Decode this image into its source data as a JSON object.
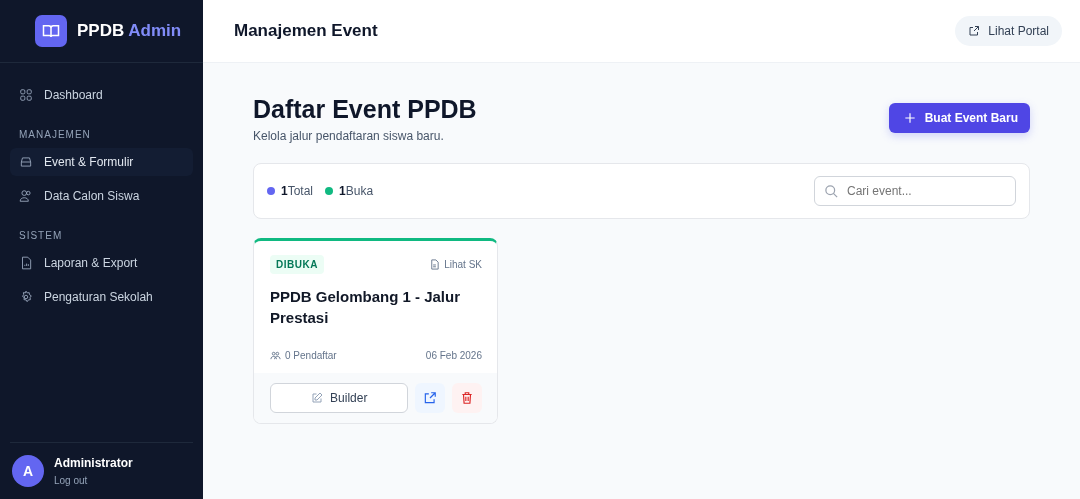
{
  "brand": {
    "name": "PPDB",
    "accent": "Admin"
  },
  "sidebar": {
    "items": [
      {
        "label": "Dashboard",
        "selected": false
      },
      {
        "section": "MANAJEMEN"
      },
      {
        "label": "Event & Formulir",
        "selected": true
      },
      {
        "label": "Data Calon Siswa",
        "selected": false
      },
      {
        "section": "SISTEM"
      },
      {
        "label": "Laporan & Export",
        "selected": false
      },
      {
        "label": "Pengaturan Sekolah",
        "selected": false
      }
    ]
  },
  "user": {
    "initial": "A",
    "name": "Administrator",
    "logout": "Log out"
  },
  "header": {
    "title": "Manajemen Event",
    "portal_button": "Lihat Portal"
  },
  "page": {
    "title": "Daftar Event PPDB",
    "subtitle": "Kelola jalur pendaftaran siswa baru.",
    "create_button": "Buat Event Baru"
  },
  "stats": [
    {
      "count": "1",
      "label": "Total",
      "color": "#6366f1"
    },
    {
      "count": "1",
      "label": "Buka",
      "color": "#10b981"
    }
  ],
  "search": {
    "placeholder": "Cari event..."
  },
  "events": [
    {
      "status": "DIBUKA",
      "open": true,
      "sk_link": "Lihat SK",
      "title": "PPDB Gelombang 1 - Jalur Prestasi",
      "registrants": "0 Pendaftar",
      "date": "06 Feb 2026",
      "builder_button": "Builder"
    }
  ]
}
